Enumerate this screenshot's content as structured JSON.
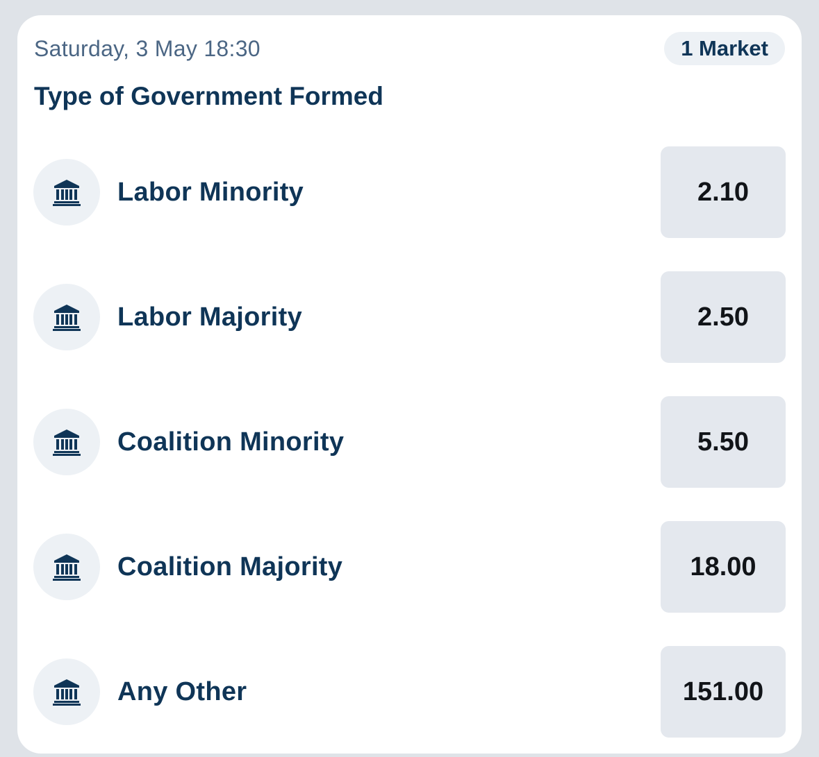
{
  "event": {
    "datetime": "Saturday, 3 May 18:30",
    "market_count": "1 Market",
    "title": "Type of Government Formed"
  },
  "outcomes": [
    {
      "label": "Labor Minority",
      "odds": "2.10",
      "icon": "parliament-icon"
    },
    {
      "label": "Labor Majority",
      "odds": "2.50",
      "icon": "parliament-icon"
    },
    {
      "label": "Coalition Minority",
      "odds": "5.50",
      "icon": "parliament-icon"
    },
    {
      "label": "Coalition Majority",
      "odds": "18.00",
      "icon": "parliament-icon"
    },
    {
      "label": "Any Other",
      "odds": "151.00",
      "icon": "parliament-icon"
    }
  ],
  "colors": {
    "primary_text": "#0f3557",
    "secondary_text": "#4b6684",
    "odds_button_bg": "#e4e8ee",
    "icon_bg": "#edf1f5",
    "page_bg": "#dfe3e8"
  }
}
